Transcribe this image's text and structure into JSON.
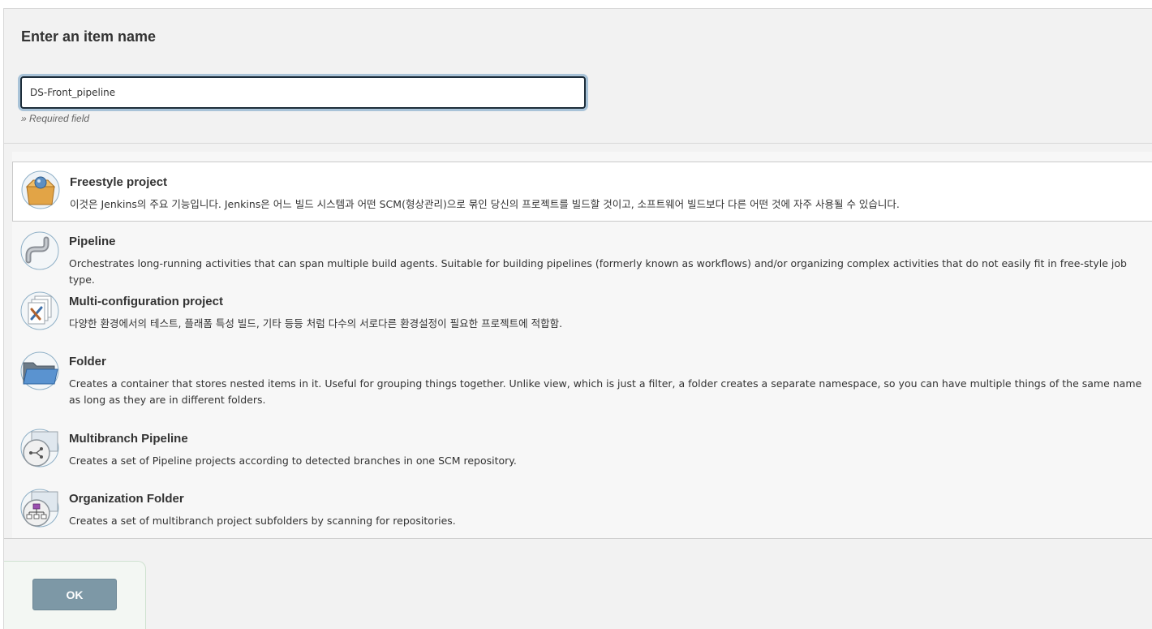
{
  "form": {
    "heading": "Enter an item name",
    "name_value": "DS-Front_pipeline",
    "required_hint": "» Required field"
  },
  "item_types": [
    {
      "title": "Freestyle project",
      "description": "이것은 Jenkins의 주요 기능입니다. Jenkins은 어느 빌드 시스템과 어떤 SCM(형상관리)으로 묶인 당신의 프로젝트를 빌드할 것이고, 소프트웨어 빌드보다 다른 어떤 것에 자주 사용될 수 있습니다.",
      "icon": "freestyle-box-icon",
      "selected": true
    },
    {
      "title": "Pipeline",
      "description": "Orchestrates long-running activities that can span multiple build agents. Suitable for building pipelines (formerly known as workflows) and/or organizing complex activities that do not easily fit in free-style job type.",
      "icon": "pipe-icon",
      "selected": false
    },
    {
      "title": "Multi-configuration project",
      "description": "다양한 환경에서의 테스트, 플래폼 특성 빌드, 기타 등등 처럼 다수의 서로다른 환경설정이 필요한 프로젝트에 적합함.",
      "icon": "multi-config-icon",
      "selected": false
    },
    {
      "title": "Folder",
      "description": "Creates a container that stores nested items in it. Useful for grouping things together. Unlike view, which is just a filter, a folder creates a separate namespace, so you can have multiple things of the same name as long as they are in different folders.",
      "icon": "folder-icon",
      "selected": false
    },
    {
      "title": "Multibranch Pipeline",
      "description": "Creates a set of Pipeline projects according to detected branches in one SCM repository.",
      "icon": "multibranch-icon",
      "selected": false
    },
    {
      "title": "Organization Folder",
      "description": "Creates a set of multibranch project subfolders by scanning for repositories.",
      "icon": "organization-folder-icon",
      "selected": false
    }
  ],
  "actions": {
    "ok_label": "OK"
  }
}
